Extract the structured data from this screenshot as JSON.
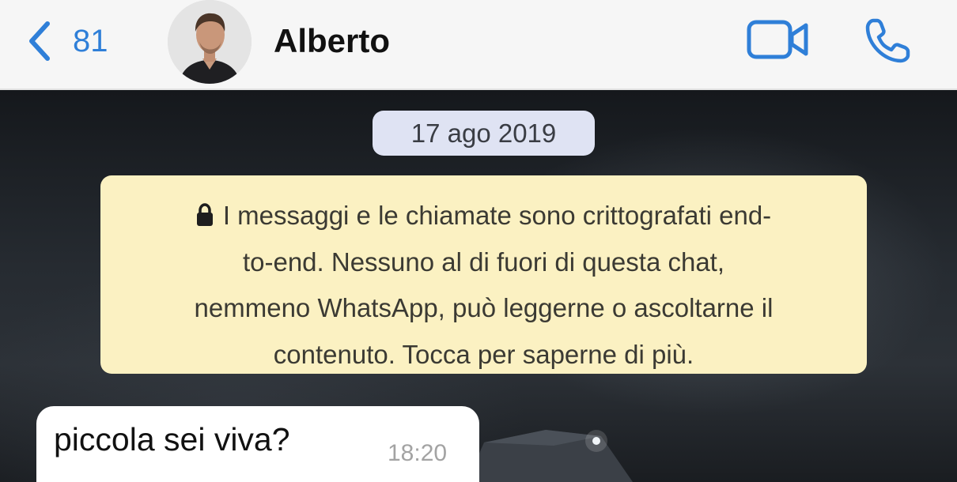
{
  "header": {
    "unread_count": "81",
    "contact_name": "Alberto",
    "accent_color": "#2f7fd8",
    "icons": [
      "chevron-left-icon",
      "video-camera-icon",
      "phone-icon"
    ]
  },
  "chat": {
    "date_label": "17 ago 2019",
    "encryption_notice": {
      "icon": "lock-icon",
      "lines": [
        "I messaggi e le chiamate sono crittografati end-",
        "to-end. Nessuno al di fuori di questa chat,",
        "nemmeno WhatsApp, può leggerne o ascoltarne il",
        "contenuto. Tocca per saperne di più."
      ]
    },
    "messages": [
      {
        "direction": "incoming",
        "text": "piccola sei viva?",
        "time": "18:20"
      }
    ]
  }
}
